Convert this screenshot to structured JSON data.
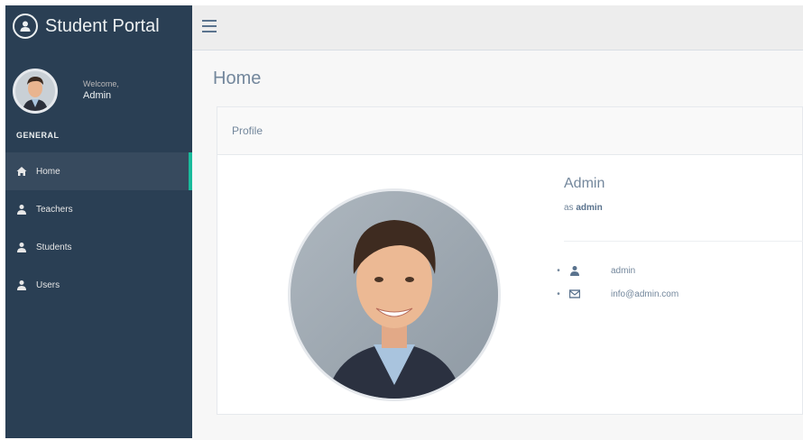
{
  "app": {
    "brand": "Student Portal"
  },
  "sidebar": {
    "welcome_label": "Welcome,",
    "user_name": "Admin",
    "section": "GENERAL",
    "items": [
      {
        "label": "Home",
        "icon": "home-icon",
        "active": true
      },
      {
        "label": "Teachers",
        "icon": "user-icon",
        "active": false
      },
      {
        "label": "Students",
        "icon": "user-icon",
        "active": false
      },
      {
        "label": "Users",
        "icon": "user-icon",
        "active": false
      }
    ]
  },
  "header": {
    "menu_icon": "hamburger-icon"
  },
  "page": {
    "title": "Home"
  },
  "profile_panel": {
    "heading": "Profile",
    "name": "Admin",
    "role_prefix": "as",
    "role": "admin",
    "details": [
      {
        "icon": "user-icon",
        "value": "admin"
      },
      {
        "icon": "envelope-icon",
        "value": "info@admin.com"
      }
    ]
  },
  "colors": {
    "sidebar_bg": "#2a3f54",
    "accent": "#1abb9c",
    "content_bg": "#f7f7f7",
    "text": "#73879c"
  }
}
